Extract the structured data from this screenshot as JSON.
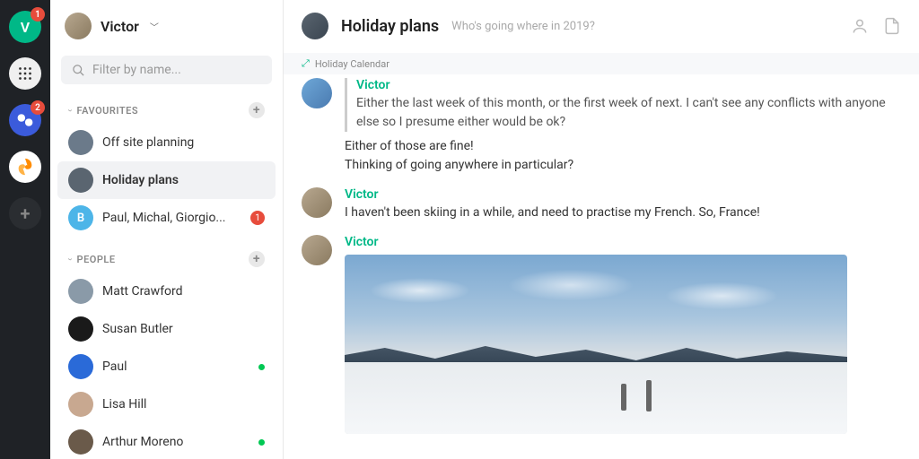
{
  "rail": {
    "items": [
      {
        "letter": "V",
        "bg": "green",
        "badge": "1"
      },
      {
        "letter": "",
        "bg": "dots",
        "badge": ""
      },
      {
        "letter": "",
        "bg": "blue",
        "badge": "2"
      },
      {
        "letter": "",
        "bg": "orange",
        "badge": ""
      }
    ]
  },
  "sidebar": {
    "username": "Victor",
    "search_placeholder": "Filter by name...",
    "sections": {
      "favourites": {
        "label": "FAVOURITES",
        "items": [
          {
            "name": "Off site planning",
            "avatar_bg": "#6b7a8a"
          },
          {
            "name": "Holiday plans",
            "avatar_bg": "#5a6570",
            "active": true
          },
          {
            "name": "Paul, Michal, Giorgio...",
            "avatar_letter": "B",
            "avatar_bg": "#4db5e8",
            "badge": "1"
          }
        ]
      },
      "people": {
        "label": "PEOPLE",
        "items": [
          {
            "name": "Matt Crawford",
            "avatar_bg": "#8a9aa8"
          },
          {
            "name": "Susan Butler",
            "avatar_bg": "#1a1a1a"
          },
          {
            "name": "Paul",
            "avatar_bg": "#2a6ad8",
            "online": true
          },
          {
            "name": "Lisa Hill",
            "avatar_bg": "#c8a890"
          },
          {
            "name": "Arthur Moreno",
            "avatar_bg": "#6a5a4a",
            "online": true
          }
        ]
      }
    }
  },
  "main": {
    "title": "Holiday plans",
    "subtitle": "Who's going where in 2019?",
    "banner": "Holiday Calendar",
    "messages": [
      {
        "author": "Victor",
        "quote": {
          "author": "Victor",
          "text": "Either the last week of this month, or the first week of next. I can't see any conflicts with anyone else so I presume either would be ok?"
        },
        "text": "Either of those are fine!\nThinking of going anywhere in particular?",
        "avatar": "blue"
      },
      {
        "author": "Victor",
        "text": "I haven't been skiing in a while, and need to practise my French. So, France!",
        "avatar": "victor"
      },
      {
        "author": "Victor",
        "text": "",
        "image": true,
        "avatar": "victor"
      }
    ]
  }
}
